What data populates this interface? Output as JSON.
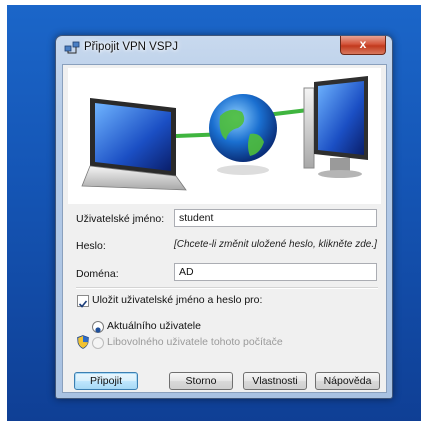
{
  "window": {
    "title": "Připojit VPN VSPJ",
    "close_glyph": "x"
  },
  "form": {
    "username_label": "Uživatelské jméno:",
    "username_value": "student",
    "password_label": "Heslo:",
    "password_hint": "[Chcete-li změnit uložené heslo, klikněte zde.]",
    "domain_label": "Doména:",
    "domain_value": "AD",
    "save_checkbox_label": "Uložit uživatelské jméno a heslo pro:",
    "save_checkbox_checked": true,
    "radio_current_user": "Aktuálního uživatele",
    "radio_any_user": "Libovolného uživatele tohoto počítače",
    "selected_radio": "current_user"
  },
  "buttons": {
    "connect": "Připojit",
    "cancel": "Storno",
    "properties": "Vlastnosti",
    "help": "Nápověda"
  },
  "icons": {
    "title_icon": "network-connection-icon",
    "shield_icon": "uac-shield-icon",
    "illustration": "laptop-globe-monitor-illustration"
  },
  "colors": {
    "desktop_blue": "#1556b6",
    "close_red": "#c23a1e",
    "link_green": "#3fb53f"
  }
}
